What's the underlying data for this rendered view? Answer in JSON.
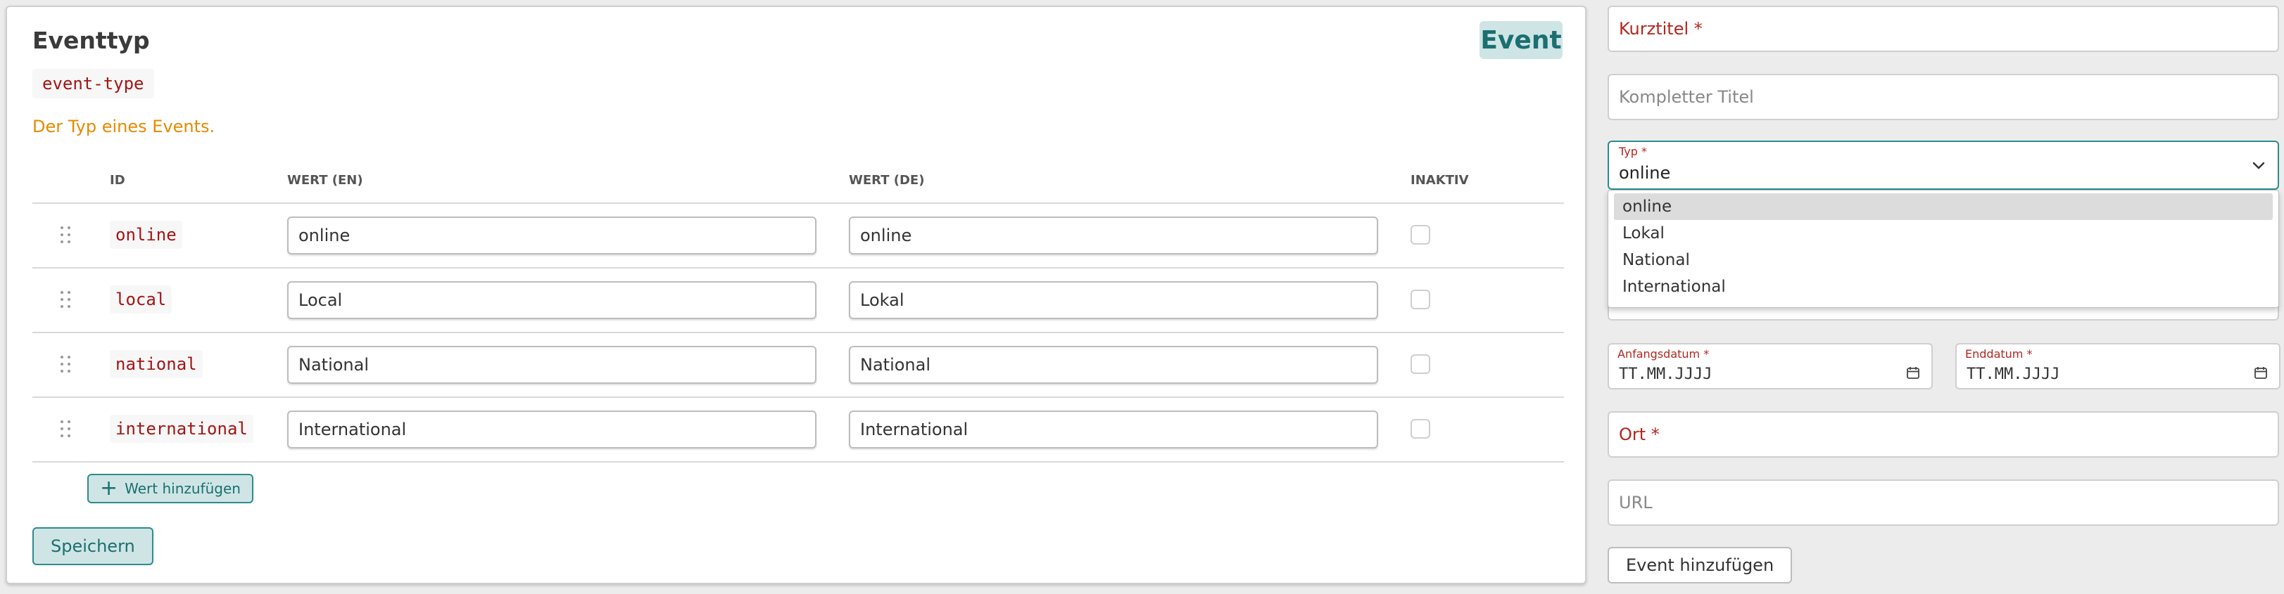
{
  "card": {
    "title": "Eventtyp",
    "badge": "Event",
    "key": "event-type",
    "description": "Der Typ eines Events."
  },
  "table": {
    "headers": {
      "id": "ID",
      "en": "WERT (EN)",
      "de": "WERT (DE)",
      "inactive": "INAKTIV"
    },
    "rows": [
      {
        "id": "online",
        "en": "online",
        "de": "online",
        "inactive": false
      },
      {
        "id": "local",
        "en": "Local",
        "de": "Lokal",
        "inactive": false
      },
      {
        "id": "national",
        "en": "National",
        "de": "National",
        "inactive": false
      },
      {
        "id": "international",
        "en": "International",
        "de": "International",
        "inactive": false
      }
    ],
    "add_label": "Wert hinzufügen",
    "save_label": "Speichern"
  },
  "form": {
    "short_title_label": "Kurztitel *",
    "full_title_placeholder": "Kompletter Titel",
    "type_label": "Typ *",
    "type_value": "online",
    "type_options": [
      "online",
      "Lokal",
      "National",
      "International"
    ],
    "start_date_label": "Anfangsdatum *",
    "end_date_label": "Enddatum *",
    "date_placeholder": "TT.MM.JJJJ",
    "location_label": "Ort *",
    "url_placeholder": "URL",
    "submit_label": "Event hinzufügen"
  },
  "icons": {
    "drag": "drag-handle-icon",
    "plus": "plus-icon",
    "chevron": "chevron-down-icon",
    "calendar": "calendar-icon"
  },
  "colors": {
    "accent": "#1b6f70",
    "accent_bg": "#cfe5e5",
    "required": "#b3261e",
    "description": "#e68a00",
    "code": "#a31515"
  }
}
